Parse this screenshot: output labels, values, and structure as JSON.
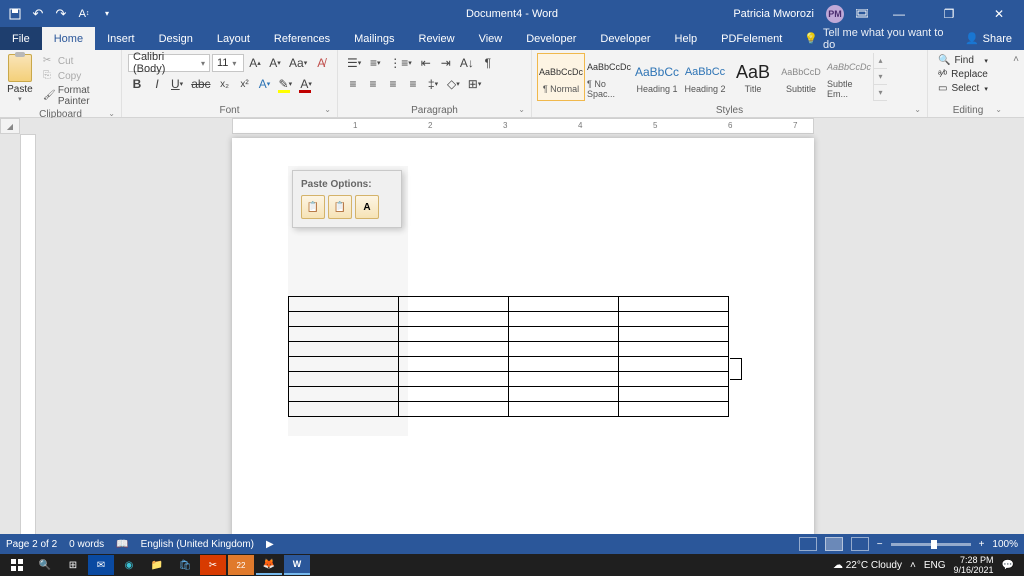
{
  "titlebar": {
    "doc_title": "Document4 - Word",
    "user_name": "Patricia Mworozi",
    "user_initials": "PM"
  },
  "tabs": {
    "file": "File",
    "items": [
      "Home",
      "Insert",
      "Design",
      "Layout",
      "References",
      "Mailings",
      "Review",
      "View",
      "Developer",
      "Developer",
      "Help",
      "PDFelement"
    ],
    "active_index": 0,
    "tellme": "Tell me what you want to do",
    "share": "Share"
  },
  "ribbon": {
    "clipboard": {
      "label": "Clipboard",
      "paste": "Paste",
      "cut": "Cut",
      "copy": "Copy",
      "fmt": "Format Painter"
    },
    "font": {
      "label": "Font",
      "name": "Calibri (Body)",
      "size": "11"
    },
    "paragraph": {
      "label": "Paragraph"
    },
    "styles": {
      "label": "Styles",
      "items": [
        {
          "preview": "AaBbCcDc",
          "name": "¶ Normal",
          "cls": ""
        },
        {
          "preview": "AaBbCcDc",
          "name": "¶ No Spac...",
          "cls": ""
        },
        {
          "preview": "AaBbCc",
          "name": "Heading 1",
          "cls": "h1"
        },
        {
          "preview": "AaBbCc",
          "name": "Heading 2",
          "cls": "h2"
        },
        {
          "preview": "AaB",
          "name": "Title",
          "cls": "title"
        },
        {
          "preview": "AaBbCcD",
          "name": "Subtitle",
          "cls": "sub"
        },
        {
          "preview": "AaBbCcDc",
          "name": "Subtle Em...",
          "cls": "em"
        }
      ]
    },
    "editing": {
      "label": "Editing",
      "find": "Find",
      "replace": "Replace",
      "select": "Select"
    }
  },
  "paste_popup": {
    "title": "Paste Options:"
  },
  "ruler_marks": [
    "1",
    "2",
    "3",
    "4",
    "5",
    "6",
    "7"
  ],
  "table": {
    "rows": 8,
    "cols": 4
  },
  "status": {
    "page": "Page 2 of 2",
    "words": "0 words",
    "lang": "English (United Kingdom)",
    "zoom": "100%"
  },
  "taskbar": {
    "weather": "22°C  Cloudy",
    "lang": "ENG",
    "time": "7:28 PM",
    "date": "9/16/2021"
  }
}
